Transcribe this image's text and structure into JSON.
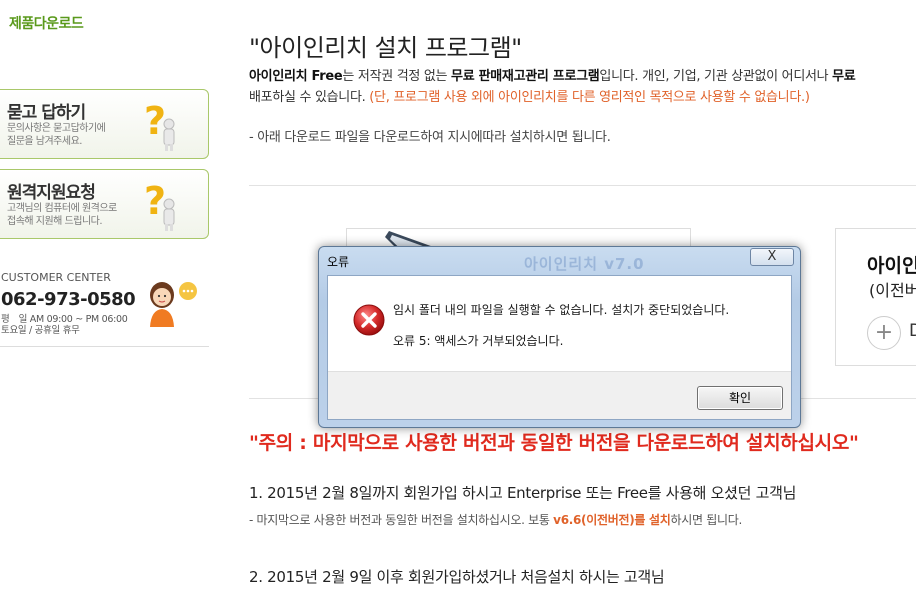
{
  "sidebar": {
    "title": "제품다운로드",
    "qna": {
      "title": "묻고 답하기",
      "desc_line1": "문의사항은 묻고답하기에",
      "desc_line2": "질문을 남겨주세요."
    },
    "remote": {
      "title": "원격지원요청",
      "desc_line1": "고객님의 컴퓨터에 원격으로",
      "desc_line2": "접속해 지원해 드립니다."
    },
    "customer_center": {
      "label": "CUSTOMER CENTER",
      "phone": "062-973-0580",
      "hours_line1": "평　일 AM 09:00 ~ PM 06:00",
      "hours_line2": "토요일 / 공휴일 휴무"
    }
  },
  "main": {
    "title": "\"아이인리치 설치 프로그램\"",
    "intro": {
      "p1": "아이인리치 Free",
      "p2": "는 저작권 걱정 없는 ",
      "p3": "무료 판매재고관리 프로그램",
      "p4": "입니다. 개인, 기업, 기관 상관없이 어디서나 ",
      "p5": "무료",
      "line2_plain": "배포하실 수 있습니다. ",
      "line2_warn": "(단, 프로그램 사용 외에 아이인리치를 다른 영리적인 목적으로 사용할 수 없습니다.)"
    },
    "instruction": "- 아래 다운로드 파일을 다운로드하여 지시에따라 설치하시면 됩니다.",
    "product_right": {
      "name": "아이인",
      "sub": "(이전버",
      "plus": "+",
      "label": "D"
    },
    "notice": "\"주의 : 마지막으로 사용한 버전과 동일한 버전을 다운로드하여 설치하십시오\"",
    "step1": "1. 2015년 2월 8일까지 회원가입 하시고 Enterprise 또는 Free를 사용해 오셨던 고객님",
    "step1_note_plain": "- 마지막으로 사용한 버전과 동일한 버전을 설치하십시오. 보통 ",
    "step1_note_hl": "v6.6(이전버전)를 설치",
    "step1_note_tail": "하시면 됩니다.",
    "step2": "2. 2015년 2월 9일 이후 회원가입하셨거나 처음설치 하시는 고객님"
  },
  "dialog": {
    "title": "오류",
    "close_label": "X",
    "ghost_text": "아이인리치 v7.0",
    "message1": "임시 폴더 내의 파일을 실행할 수 없습니다. 설치가 중단되었습니다.",
    "message2": "오류 5: 액세스가 거부되었습니다.",
    "ok_label": "확인"
  },
  "colors": {
    "accent_green": "#5a9a1c",
    "warning_orange": "#e0622a",
    "notice_red": "#e02a1e",
    "error_icon_red": "#d42a2a"
  }
}
